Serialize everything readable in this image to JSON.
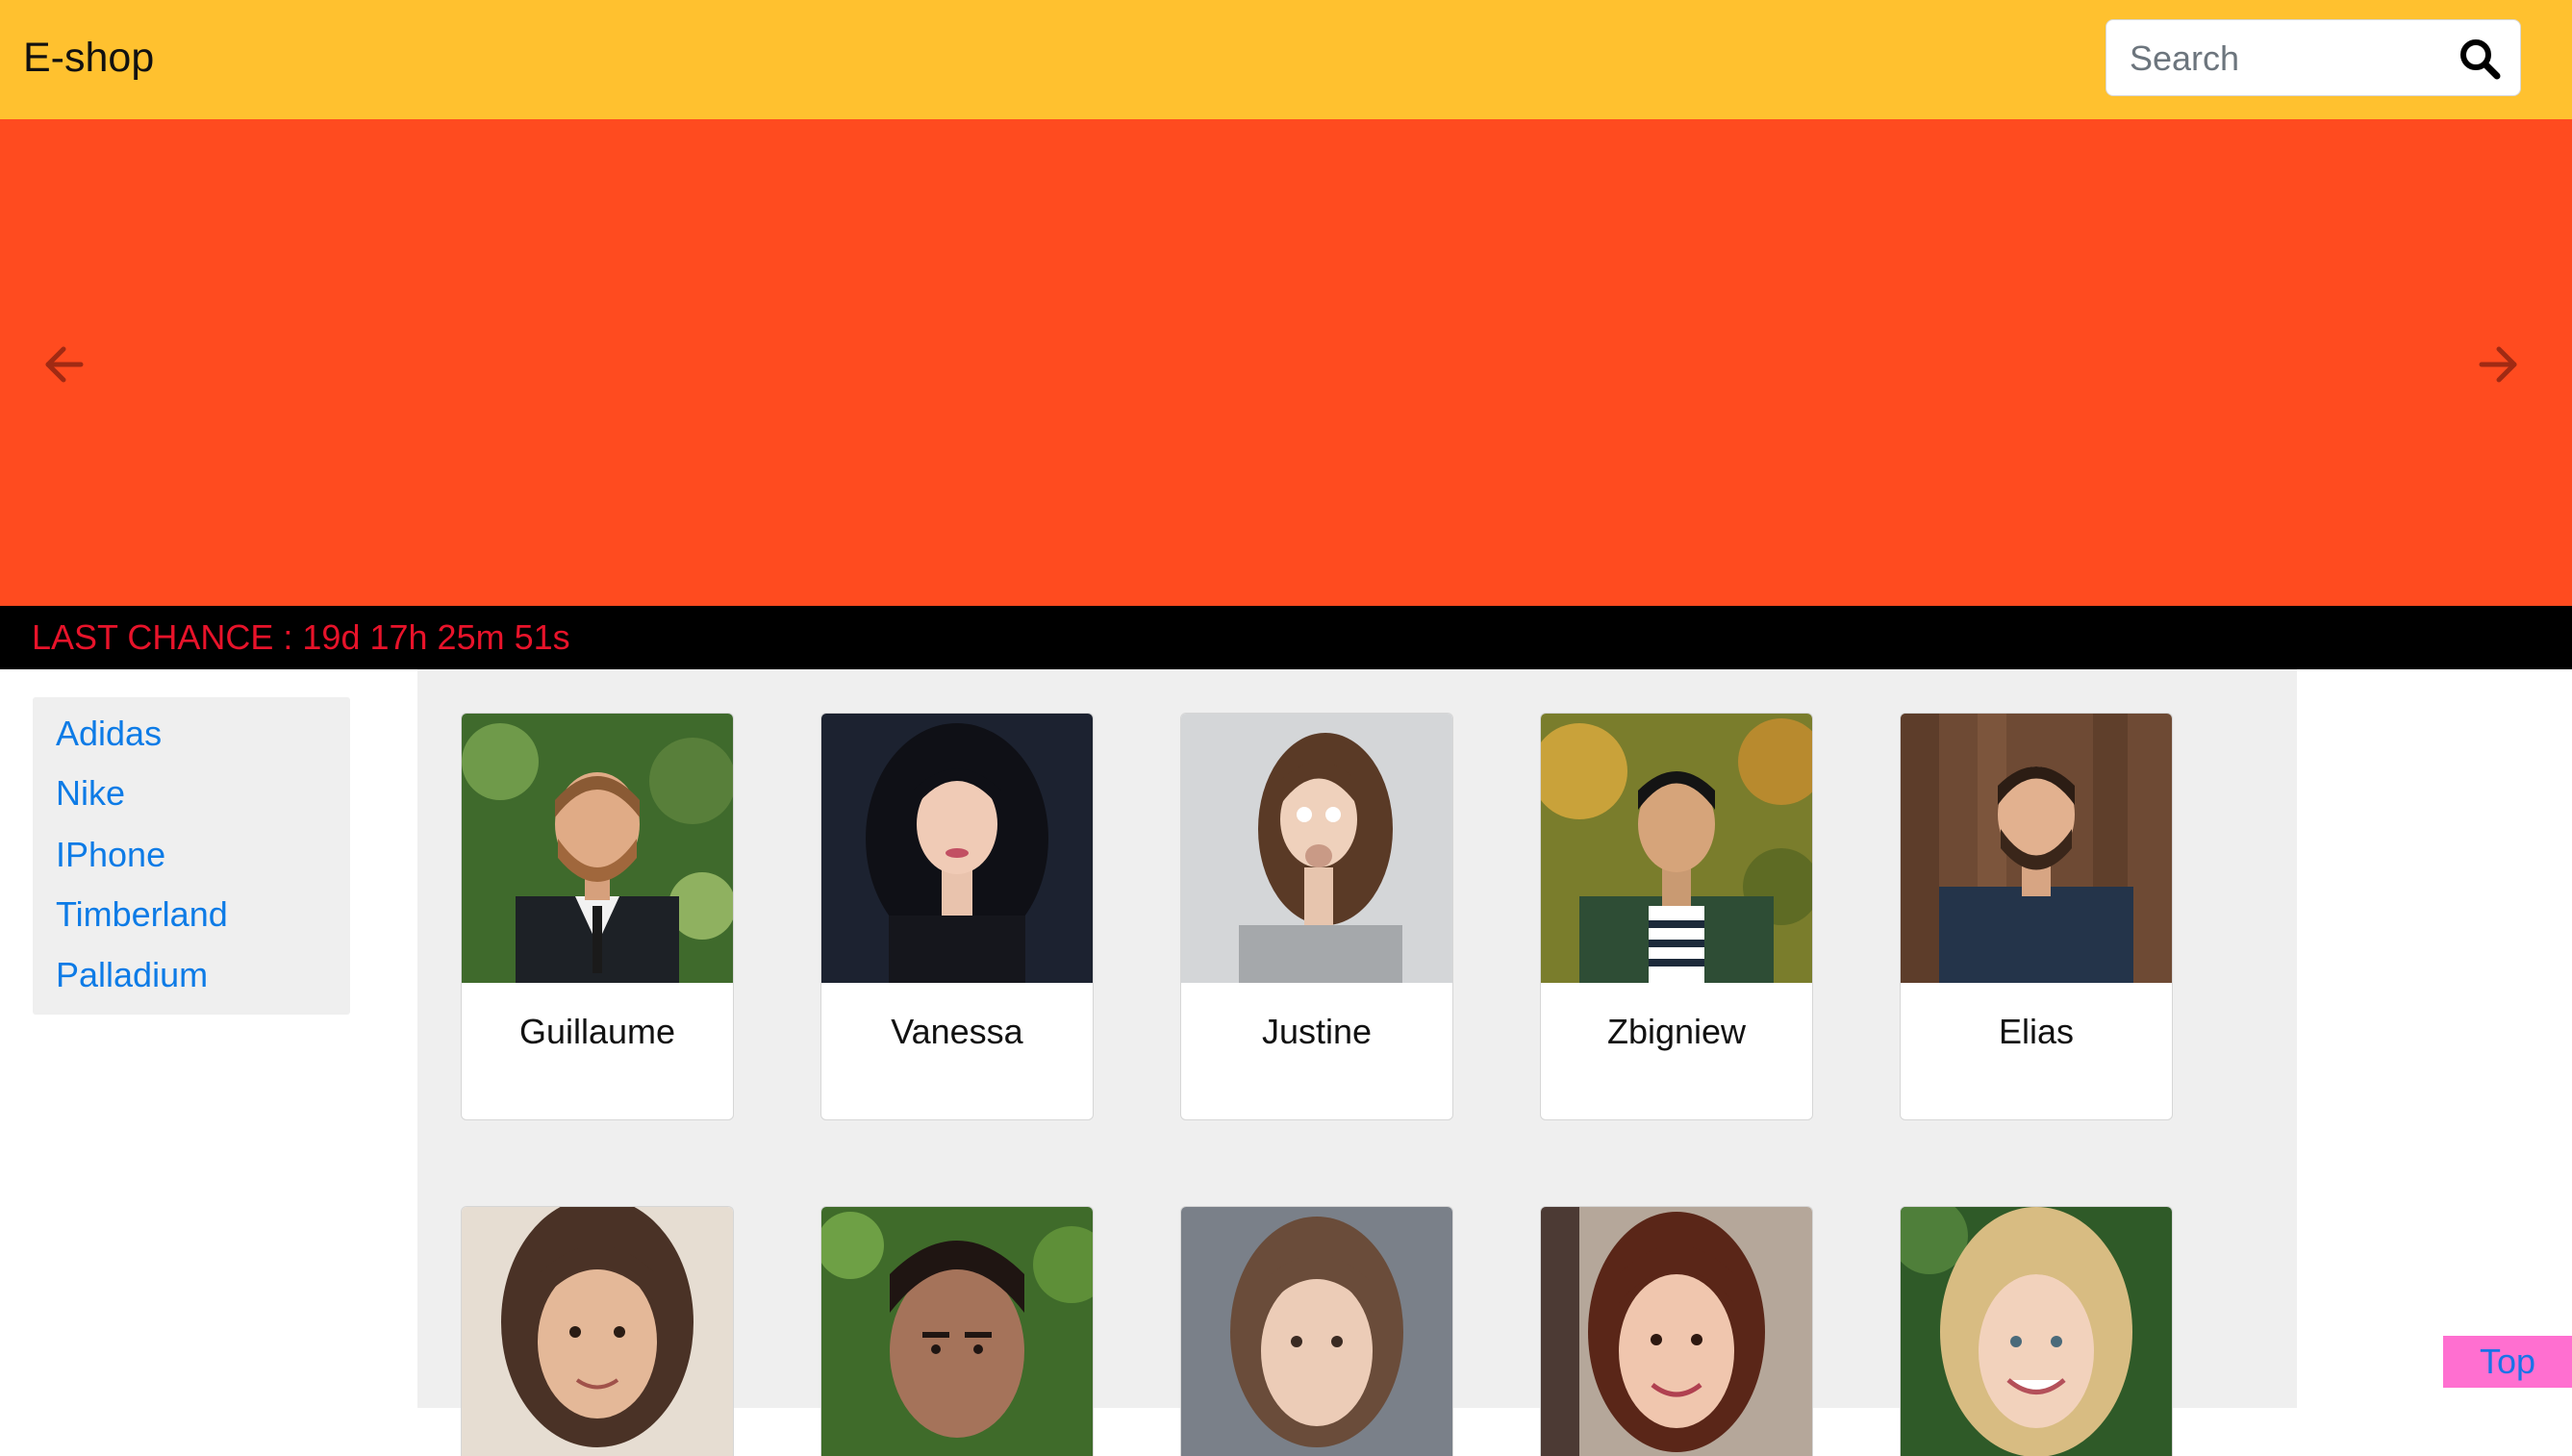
{
  "header": {
    "brand": "E-shop",
    "search": {
      "placeholder": "Search",
      "value": ""
    },
    "colors": {
      "background": "#ffc12f"
    }
  },
  "hero": {
    "color": "#ff4b1f",
    "prev_icon": "arrow-left-icon",
    "next_icon": "arrow-right-icon"
  },
  "countdown": {
    "text": "LAST CHANCE : 19d 17h 25m 51s",
    "text_color": "#e8132a"
  },
  "sidebar": {
    "items": [
      {
        "label": "Adidas"
      },
      {
        "label": "Nike"
      },
      {
        "label": "IPhone"
      },
      {
        "label": "Timberland"
      },
      {
        "label": "Palladium"
      }
    ]
  },
  "products": [
    {
      "name": "Guillaume"
    },
    {
      "name": "Vanessa"
    },
    {
      "name": "Justine"
    },
    {
      "name": "Zbigniew"
    },
    {
      "name": "Elias"
    }
  ],
  "top_button": {
    "label": "Top"
  }
}
